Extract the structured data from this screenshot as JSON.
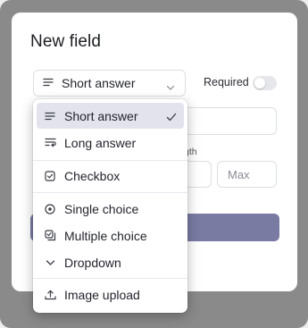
{
  "modal": {
    "title": "New field",
    "type_select": {
      "label": "Short answer",
      "icon": "short-text-icon"
    },
    "required": {
      "label": "Required",
      "enabled": false
    },
    "length_label": "gth",
    "max_placeholder": "Max"
  },
  "dropdown": {
    "items": [
      {
        "label": "Short answer",
        "icon": "short-text-icon",
        "selected": true
      },
      {
        "label": "Long answer",
        "icon": "long-text-icon",
        "selected": false
      },
      {
        "label": "Checkbox",
        "icon": "checkbox-icon",
        "selected": false
      },
      {
        "label": "Single choice",
        "icon": "radio-icon",
        "selected": false
      },
      {
        "label": "Multiple choice",
        "icon": "multi-choice-icon",
        "selected": false
      },
      {
        "label": "Dropdown",
        "icon": "chevron-down-icon",
        "selected": false
      },
      {
        "label": "Image upload",
        "icon": "upload-icon",
        "selected": false
      }
    ]
  },
  "colors": {
    "accent": "#7a7ba3",
    "selected_bg": "#e2e3ec",
    "backdrop": "#8a8a8a"
  }
}
